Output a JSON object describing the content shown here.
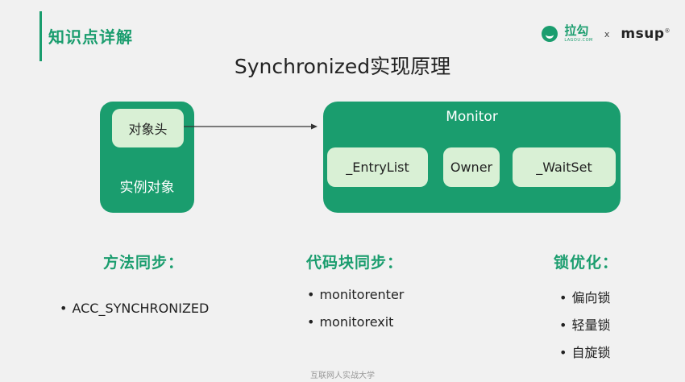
{
  "header": {
    "section_title": "知识点详解",
    "logo_lagou": "拉勾",
    "logo_lagou_sub": "LAGOU.COM",
    "logo_separator": "x",
    "logo_msup": "msup",
    "logo_msup_mark": "®"
  },
  "title": "Synchronized实现原理",
  "diagram": {
    "object_header": "对象头",
    "instance_label": "实例对象",
    "monitor_label": "Monitor",
    "entry_list": "_EntryList",
    "owner": "Owner",
    "wait_set": "_WaitSet"
  },
  "columns": {
    "method": {
      "heading": "方法同步：",
      "items": [
        "ACC_SYNCHRONIZED"
      ]
    },
    "block": {
      "heading": "代码块同步：",
      "items": [
        "monitorenter",
        "monitorexit"
      ]
    },
    "lock": {
      "heading": "锁优化：",
      "items": [
        "偏向锁",
        "轻量锁",
        "自旋锁"
      ]
    }
  },
  "footer": "互联网人实战大学",
  "colors": {
    "accent": "#1a9d6e",
    "light_box": "#d9f0d5",
    "background": "#f1f1f1"
  },
  "icons": {
    "lagou_logo": "lagou-logo-icon"
  }
}
